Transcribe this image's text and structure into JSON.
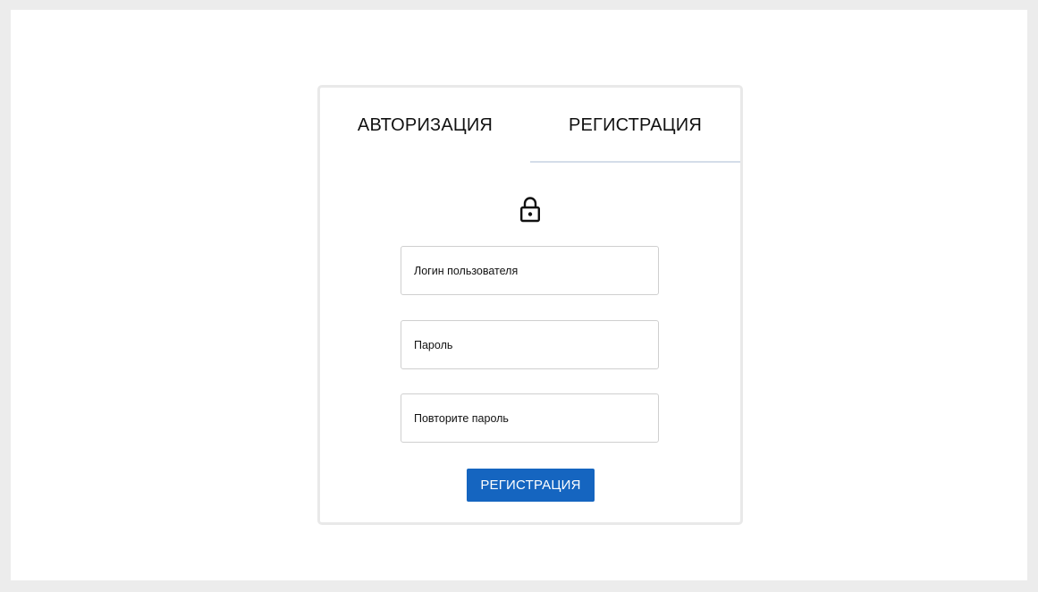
{
  "tabs": {
    "login_label": "АВТОРИЗАЦИЯ",
    "register_label": "РЕГИСТРАЦИЯ",
    "active": "register"
  },
  "icons": {
    "lock": "lock-icon"
  },
  "form": {
    "login": {
      "placeholder": "Логин пользователя",
      "value": ""
    },
    "password": {
      "placeholder": "Пароль",
      "value": ""
    },
    "repeat_password": {
      "placeholder": "Повторите пароль",
      "value": ""
    },
    "submit_label": "РЕГИСТРАЦИЯ"
  },
  "colors": {
    "page_background": "#ececec",
    "card_border": "#e9e9e9",
    "tab_indicator": "#d4dde9",
    "button": "#1565c0",
    "button_text": "#ffffff",
    "text": "#111111"
  }
}
